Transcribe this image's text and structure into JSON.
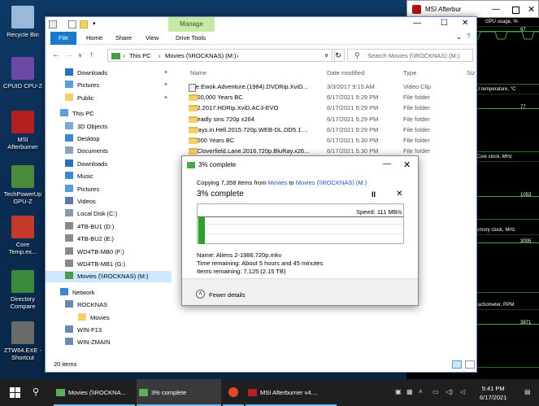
{
  "desktop": {
    "icons": [
      {
        "label": "Recycle Bin",
        "color": "#9ab8d8"
      },
      {
        "label": "CPUID CPU-Z",
        "color": "#6a4aa6"
      },
      {
        "label": "MSI Afterburner",
        "color": "#b32020"
      },
      {
        "label": "TechPowerUp GPU-Z",
        "color": "#4a8a3a"
      },
      {
        "label": "Core Temp.ex...",
        "color": "#c43a2a"
      },
      {
        "label": "Directory Compare",
        "color": "#3a8a3a"
      },
      {
        "label": "ZTW64.EXE - Shortcut",
        "color": "#6a6a6a"
      }
    ]
  },
  "afterburner": {
    "title": "MSI Afterbur",
    "graphs": [
      {
        "label": "GPU usage, %",
        "value": "97",
        "line_value": ""
      },
      {
        "label": "U temperature, °C",
        "value": "77",
        "line_value": ""
      },
      {
        "label": "Core clock, MHz",
        "value": "1053",
        "line_value": ""
      },
      {
        "label": "emory clock, MHz",
        "value": "3005",
        "line_value": ""
      },
      {
        "label": "tachometer, RPM",
        "value": "3971",
        "line_value": ""
      }
    ]
  },
  "explorer": {
    "ribbon": {
      "manage": "Manage",
      "tabs": [
        "File",
        "Home",
        "Share",
        "View",
        "Drive Tools"
      ]
    },
    "address": {
      "segments": [
        "This PC",
        "Movies (\\\\ROCKNAS) (M:)"
      ],
      "search_placeholder": "Search Movies (\\\\ROCKNAS) (M:)"
    },
    "nav": [
      {
        "label": "Downloads",
        "pinned": true,
        "color": "#2a6fc0",
        "level": 1
      },
      {
        "label": "Pictures",
        "pinned": true,
        "color": "#5aa0d8",
        "level": 1
      },
      {
        "label": "Public",
        "pinned": true,
        "color": "#f4d06b",
        "level": 1
      },
      {
        "label": "This PC",
        "pinned": false,
        "color": "#5aa0d8",
        "level": 0
      },
      {
        "label": "3D Objects",
        "pinned": false,
        "color": "#7aa8d8",
        "level": 1
      },
      {
        "label": "Desktop",
        "pinned": false,
        "color": "#3a88d0",
        "level": 1
      },
      {
        "label": "Documents",
        "pinned": false,
        "color": "#8aa4c0",
        "level": 1
      },
      {
        "label": "Downloads",
        "pinned": false,
        "color": "#2a6fc0",
        "level": 1
      },
      {
        "label": "Music",
        "pinned": false,
        "color": "#3a88d0",
        "level": 1
      },
      {
        "label": "Pictures",
        "pinned": false,
        "color": "#5aa0d8",
        "level": 1
      },
      {
        "label": "Videos",
        "pinned": false,
        "color": "#5a7aa8",
        "level": 1
      },
      {
        "label": "Local Disk (C:)",
        "pinned": false,
        "color": "#8a9aaa",
        "level": 1
      },
      {
        "label": "4TB-BU1 (D:)",
        "pinned": false,
        "color": "#8a8a8a",
        "level": 1
      },
      {
        "label": "4TB-BU2 (E:)",
        "pinned": false,
        "color": "#8a8a8a",
        "level": 1
      },
      {
        "label": "WD4TB-MB0 (F:)",
        "pinned": false,
        "color": "#8a8a8a",
        "level": 1
      },
      {
        "label": "WD4TB-MB1 (G:)",
        "pinned": false,
        "color": "#8a8a8a",
        "level": 1
      },
      {
        "label": "Movies (\\\\ROCKNAS) (M:)",
        "pinned": false,
        "color": "#4a9a4a",
        "level": 1,
        "selected": true
      },
      {
        "label": "Network",
        "pinned": false,
        "color": "#3a88d0",
        "level": 0
      },
      {
        "label": "ROCKNAS",
        "pinned": false,
        "color": "#6a8ab0",
        "level": 1
      },
      {
        "label": "Movies",
        "pinned": false,
        "color": "#f4d06b",
        "level": 2
      },
      {
        "label": "WIN-F13",
        "pinned": false,
        "color": "#6a8ab0",
        "level": 1
      },
      {
        "label": "WIN-ZMAIN",
        "pinned": false,
        "color": "#6a8ab0",
        "level": 1
      }
    ],
    "columns": [
      "Name",
      "Date modified",
      "Type",
      "Siz"
    ],
    "files": [
      {
        "name": "The.Ewok.Adventure.(1984).DVDRip.XviD...",
        "date": "3/3/2017 9:15 AM",
        "type": "Video Clip",
        "kind": "video"
      },
      {
        "name": "1,000,000 Years BC",
        "date": "6/17/2021 5:29 PM",
        "type": "File folder",
        "kind": "folder"
      },
      {
        "name": "2.22.2017.HDRip.XviD.AC3-EVO",
        "date": "6/17/2021 5:29 PM",
        "type": "File folder",
        "kind": "folder"
      },
      {
        "name": "7 deadly sins 720p x264",
        "date": "6/17/2021 5:29 PM",
        "type": "File folder",
        "kind": "folder"
      },
      {
        "name": "7.Days.in.Hell.2015.720p.WEB-DL.DD5.1....",
        "date": "6/17/2021 5:29 PM",
        "type": "File folder",
        "kind": "folder"
      },
      {
        "name": "10,000 Years BC",
        "date": "6/17/2021 5:30 PM",
        "type": "File folder",
        "kind": "folder"
      },
      {
        "name": "10.Cloverfield.Lane.2016.720p.BluRay.x26...",
        "date": "6/17/2021 5:30 PM",
        "type": "File folder",
        "kind": "folder"
      }
    ],
    "status": "20 items"
  },
  "copy_dialog": {
    "title": "3% complete",
    "copy_prefix": "Copying 7,358 items from ",
    "copy_from": "Movies",
    "copy_mid": " to ",
    "copy_to": "Movies (\\\\ROCKNAS) (M:)",
    "percent_label": "3% complete",
    "progress_fraction": 0.03,
    "speed": "Speed: 111 MB/s",
    "name_line": "Name:  Aliens 2-1986.720p.mkv",
    "time_line": "Time remaining:  About 5 hours and 45 minutes",
    "items_line": "Items remaining:  7,125 (2.15 TB)",
    "fewer_details": "Fewer details"
  },
  "taskbar": {
    "items": [
      {
        "label": "Movies (\\\\ROCKNA...",
        "color": "#5ab05a"
      },
      {
        "label": "3% complete",
        "color": "#5ab05a",
        "active": true
      },
      {
        "label": "",
        "color": "#e8452c"
      },
      {
        "label": "MSI Afterburner v4....",
        "color": "#b32020"
      }
    ],
    "time": "5:41 PM",
    "date": "6/17/2021"
  }
}
